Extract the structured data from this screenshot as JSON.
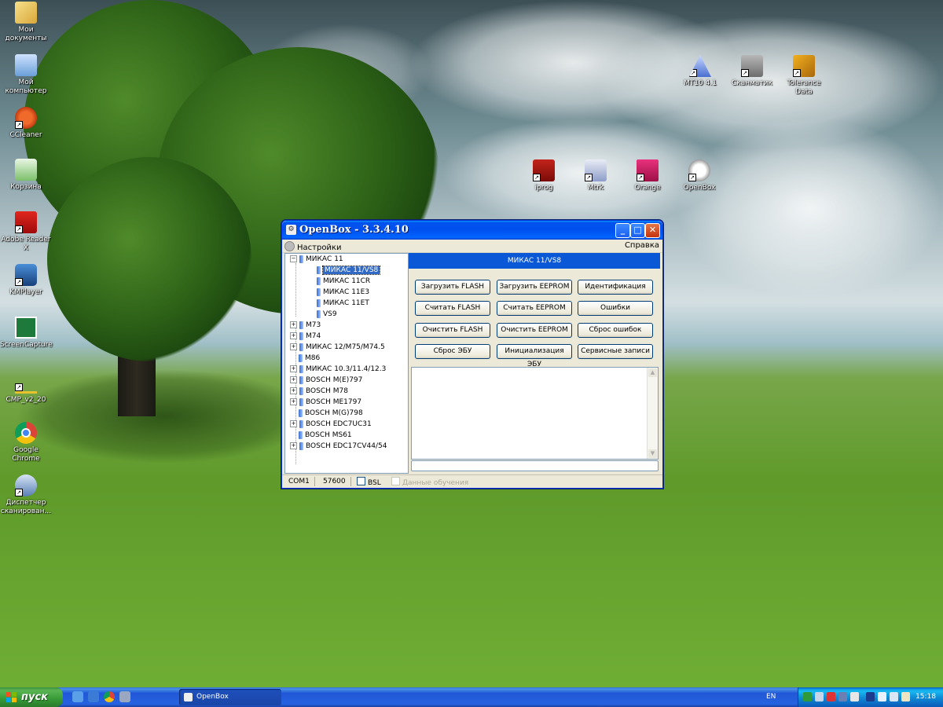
{
  "desktop": {
    "icons_left": [
      {
        "label": "Мои документы",
        "icon": "my-documents-icon"
      },
      {
        "label": "Мой компьютер",
        "icon": "my-computer-icon"
      },
      {
        "label": "CCleaner",
        "icon": "ccleaner-icon"
      },
      {
        "label": "Корзина",
        "icon": "recycle-bin-icon"
      },
      {
        "label": "Adobe Reader X",
        "icon": "adobe-reader-icon"
      },
      {
        "label": "KMPlayer",
        "icon": "kmplayer-icon"
      },
      {
        "label": "ScreenCapture",
        "icon": "screencapture-icon"
      },
      {
        "label": "CMP_v2_20",
        "icon": "cmp-icon"
      },
      {
        "label": "Google Chrome",
        "icon": "chrome-icon"
      },
      {
        "label": "Диспетчер сканирован...",
        "icon": "scanner-manager-icon"
      }
    ],
    "icons_right_top": [
      {
        "label": "MT10 4.1",
        "icon": "mt10-icon"
      },
      {
        "label": "Сканматик",
        "icon": "scanmatik-icon"
      },
      {
        "label": "Tolerance Data",
        "icon": "tolerance-data-icon"
      }
    ],
    "icons_right_mid": [
      {
        "label": "iprog",
        "icon": "iprog-icon"
      },
      {
        "label": "Mtrk",
        "icon": "mtrk-icon"
      },
      {
        "label": "Orange",
        "icon": "orange-icon"
      },
      {
        "label": "OpenBox",
        "icon": "openbox-icon"
      }
    ]
  },
  "window": {
    "title": "OpenBox - 3.3.4.10",
    "menu": {
      "settings": "Настройки",
      "help": "Справка"
    },
    "tree": [
      {
        "label": "МИКАС 11",
        "expanded": true,
        "children": [
          {
            "label": "МИКАС 11/VS8",
            "selected": true
          },
          {
            "label": "МИКАС 11CR"
          },
          {
            "label": "МИКАС 11E3"
          },
          {
            "label": "МИКАС 11ET"
          },
          {
            "label": "VS9"
          }
        ]
      },
      {
        "label": "M73",
        "expandable": true
      },
      {
        "label": "M74",
        "expandable": true
      },
      {
        "label": "МИКАС 12/M75/M74.5",
        "expandable": true
      },
      {
        "label": "M86",
        "expandable": false
      },
      {
        "label": "МИКАС 10.3/11.4/12.3",
        "expandable": true
      },
      {
        "label": "BOSCH M(E)797",
        "expandable": true
      },
      {
        "label": "BOSCH M78",
        "expandable": true
      },
      {
        "label": "BOSCH ME1797",
        "expandable": true
      },
      {
        "label": "BOSCH M(G)798",
        "expandable": false
      },
      {
        "label": "BOSCH EDC7UC31",
        "expandable": true
      },
      {
        "label": "BOSCH MS61",
        "expandable": false
      },
      {
        "label": "BOSCH EDC17CV44/54",
        "expandable": true
      }
    ],
    "panel_title": "МИКАС 11/VS8",
    "buttons": [
      [
        "Загрузить FLASH",
        "Загрузить EEPROM",
        "Идентификация"
      ],
      [
        "Считать FLASH",
        "Считать EEPROM",
        "Ошибки"
      ],
      [
        "Очистить FLASH",
        "Очистить EEPROM",
        "Сброс ошибок"
      ],
      [
        "Сброс ЭБУ",
        "Инициализация ЭБУ",
        "Сервисные записи"
      ]
    ],
    "status": {
      "port": "COM1",
      "baud": "57600",
      "bsl": "BSL",
      "learning": "Данные обучения"
    }
  },
  "taskbar": {
    "start": "пуск",
    "task": "OpenBox",
    "lang": "EN",
    "clock": "15:18"
  },
  "colors": {
    "accent": "#0a58d6",
    "selection": "#316ac5",
    "taskbar": "#2663e0",
    "start": "#379a37"
  }
}
